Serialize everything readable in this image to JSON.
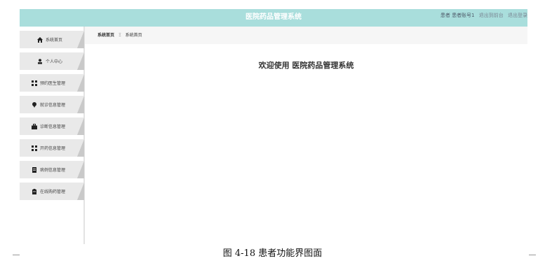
{
  "header": {
    "title": "医院药品管理系统",
    "user_role": "患者",
    "user_name": "患者账号1",
    "front_link": "退出到前台",
    "logout_link": "退出登录"
  },
  "sidebar": {
    "items": [
      {
        "label": "系统首页",
        "icon": "home-icon"
      },
      {
        "label": "个人中心",
        "icon": "user-icon"
      },
      {
        "label": "预约医生管理",
        "icon": "grid-icon"
      },
      {
        "label": "就诊信息管理",
        "icon": "pin-icon"
      },
      {
        "label": "诊断信息管理",
        "icon": "briefcase-icon"
      },
      {
        "label": "开药信息管理",
        "icon": "grid-icon"
      },
      {
        "label": "病例信息管理",
        "icon": "document-icon"
      },
      {
        "label": "在线购药管理",
        "icon": "clipboard-icon"
      }
    ]
  },
  "breadcrumb": {
    "root": "系统首页",
    "separator": "Ξ",
    "current": "系统首页"
  },
  "main": {
    "welcome": "欢迎使用 医院药品管理系统"
  },
  "caption": "图 4-18 患者功能界图面",
  "colors": {
    "header_bg": "#a9dedc",
    "menu_bg": "#e9e9e9"
  }
}
